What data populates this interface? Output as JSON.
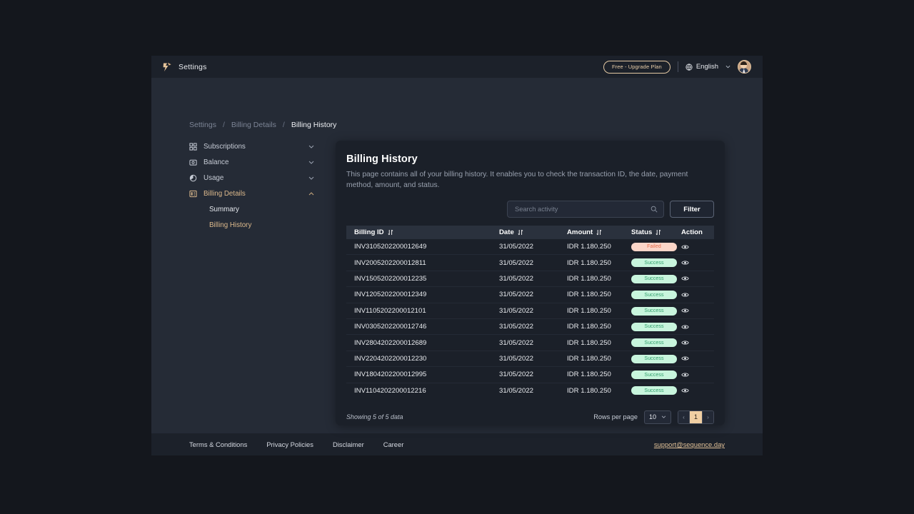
{
  "topbar": {
    "logo_icon": "sequence-logo-icon",
    "title": "Settings",
    "plan_badge": "Free - Upgrade Plan",
    "language": "English",
    "globe_icon": "globe-icon",
    "caret_icon": "chevron-down-icon",
    "avatar_icon": "user-avatar"
  },
  "breadcrumb": {
    "items": [
      "Settings",
      "Billing Details",
      "Billing History"
    ],
    "separator": "/"
  },
  "sidebar": {
    "items": [
      {
        "label": "Subscriptions",
        "icon": "grid-icon",
        "chevron": "chevron-down-icon",
        "active": false
      },
      {
        "label": "Balance",
        "icon": "wallet-icon",
        "chevron": "chevron-down-icon",
        "active": false
      },
      {
        "label": "Usage",
        "icon": "pie-chart-icon",
        "chevron": "chevron-down-icon",
        "active": false
      },
      {
        "label": "Billing Details",
        "icon": "billing-card-icon",
        "chevron": "chevron-up-icon",
        "active": true
      }
    ],
    "sub_items": [
      {
        "label": "Summary",
        "active": false
      },
      {
        "label": "Billing History",
        "active": true
      }
    ]
  },
  "card": {
    "title": "Billing History",
    "description": "This page contains all of your billing history. It enables you to check the transaction ID, the date, payment method, amount, and status.",
    "search": {
      "placeholder": "Search activity",
      "value": "",
      "icon": "search-icon"
    },
    "filter_label": "Filter"
  },
  "table": {
    "columns": [
      {
        "label": "Billing ID",
        "sortable": true
      },
      {
        "label": "Date",
        "sortable": true
      },
      {
        "label": "Amount",
        "sortable": true
      },
      {
        "label": "Status",
        "sortable": true
      },
      {
        "label": "Action",
        "sortable": false
      }
    ],
    "sort_icon": "sort-icon",
    "action_icon": "eye-icon",
    "rows": [
      {
        "billing_id": "INV3105202200012649",
        "date": "31/05/2022",
        "amount": "IDR 1.180.250",
        "status": "Failed"
      },
      {
        "billing_id": "INV2005202200012811",
        "date": "31/05/2022",
        "amount": "IDR 1.180.250",
        "status": "Success"
      },
      {
        "billing_id": "INV1505202200012235",
        "date": "31/05/2022",
        "amount": "IDR 1.180.250",
        "status": "Success"
      },
      {
        "billing_id": "INV1205202200012349",
        "date": "31/05/2022",
        "amount": "IDR 1.180.250",
        "status": "Success"
      },
      {
        "billing_id": "INV1105202200012101",
        "date": "31/05/2022",
        "amount": "IDR 1.180.250",
        "status": "Success"
      },
      {
        "billing_id": "INV0305202200012746",
        "date": "31/05/2022",
        "amount": "IDR 1.180.250",
        "status": "Success"
      },
      {
        "billing_id": "INV2804202200012689",
        "date": "31/05/2022",
        "amount": "IDR 1.180.250",
        "status": "Success"
      },
      {
        "billing_id": "INV2204202200012230",
        "date": "31/05/2022",
        "amount": "IDR 1.180.250",
        "status": "Success"
      },
      {
        "billing_id": "INV1804202200012995",
        "date": "31/05/2022",
        "amount": "IDR 1.180.250",
        "status": "Success"
      },
      {
        "billing_id": "INV1104202200012216",
        "date": "31/05/2022",
        "amount": "IDR 1.180.250",
        "status": "Success"
      }
    ]
  },
  "pagination": {
    "showing": "Showing 5 of 5 data",
    "rows_per_page_label": "Rows per page",
    "rows_per_page_value": "10",
    "prev": "‹",
    "current_page": "1",
    "next": "›"
  },
  "footer": {
    "links": [
      "Terms & Conditions",
      "Privacy Policies",
      "Disclaimer",
      "Career"
    ],
    "email": "support@sequence.day"
  },
  "colors": {
    "accent": "#dcb98c",
    "badge_success_bg": "#c8f5dd",
    "badge_success_text": "#2f9e6a",
    "badge_failed_bg": "#fbd5c8",
    "badge_failed_text": "#e56a4a",
    "page_active_bg": "#f0cfa3"
  }
}
